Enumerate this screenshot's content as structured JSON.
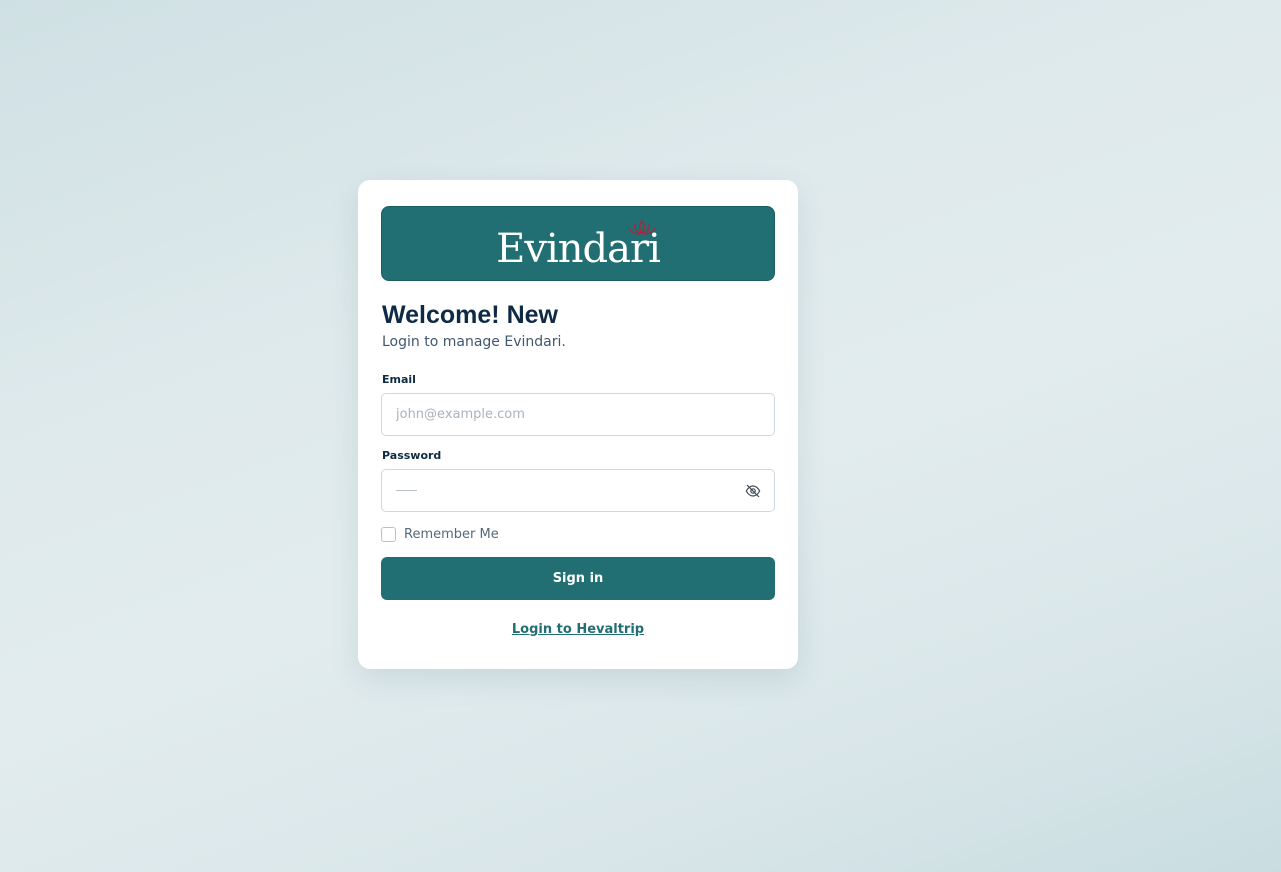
{
  "brand": {
    "logo_text": "Evindari",
    "banner_color": "#216f73",
    "accent_color": "#b0223a"
  },
  "login": {
    "title": "Welcome! New",
    "subtitle": "Login to manage Evindari.",
    "email_label": "Email",
    "email_placeholder": "john@example.com",
    "password_label": "Password",
    "password_toggle_icon": "eye-off-icon",
    "remember_label": "Remember Me",
    "remember_checked": false,
    "signin_label": "Sign in",
    "alt_login_link": "Login to Hevaltrip"
  }
}
